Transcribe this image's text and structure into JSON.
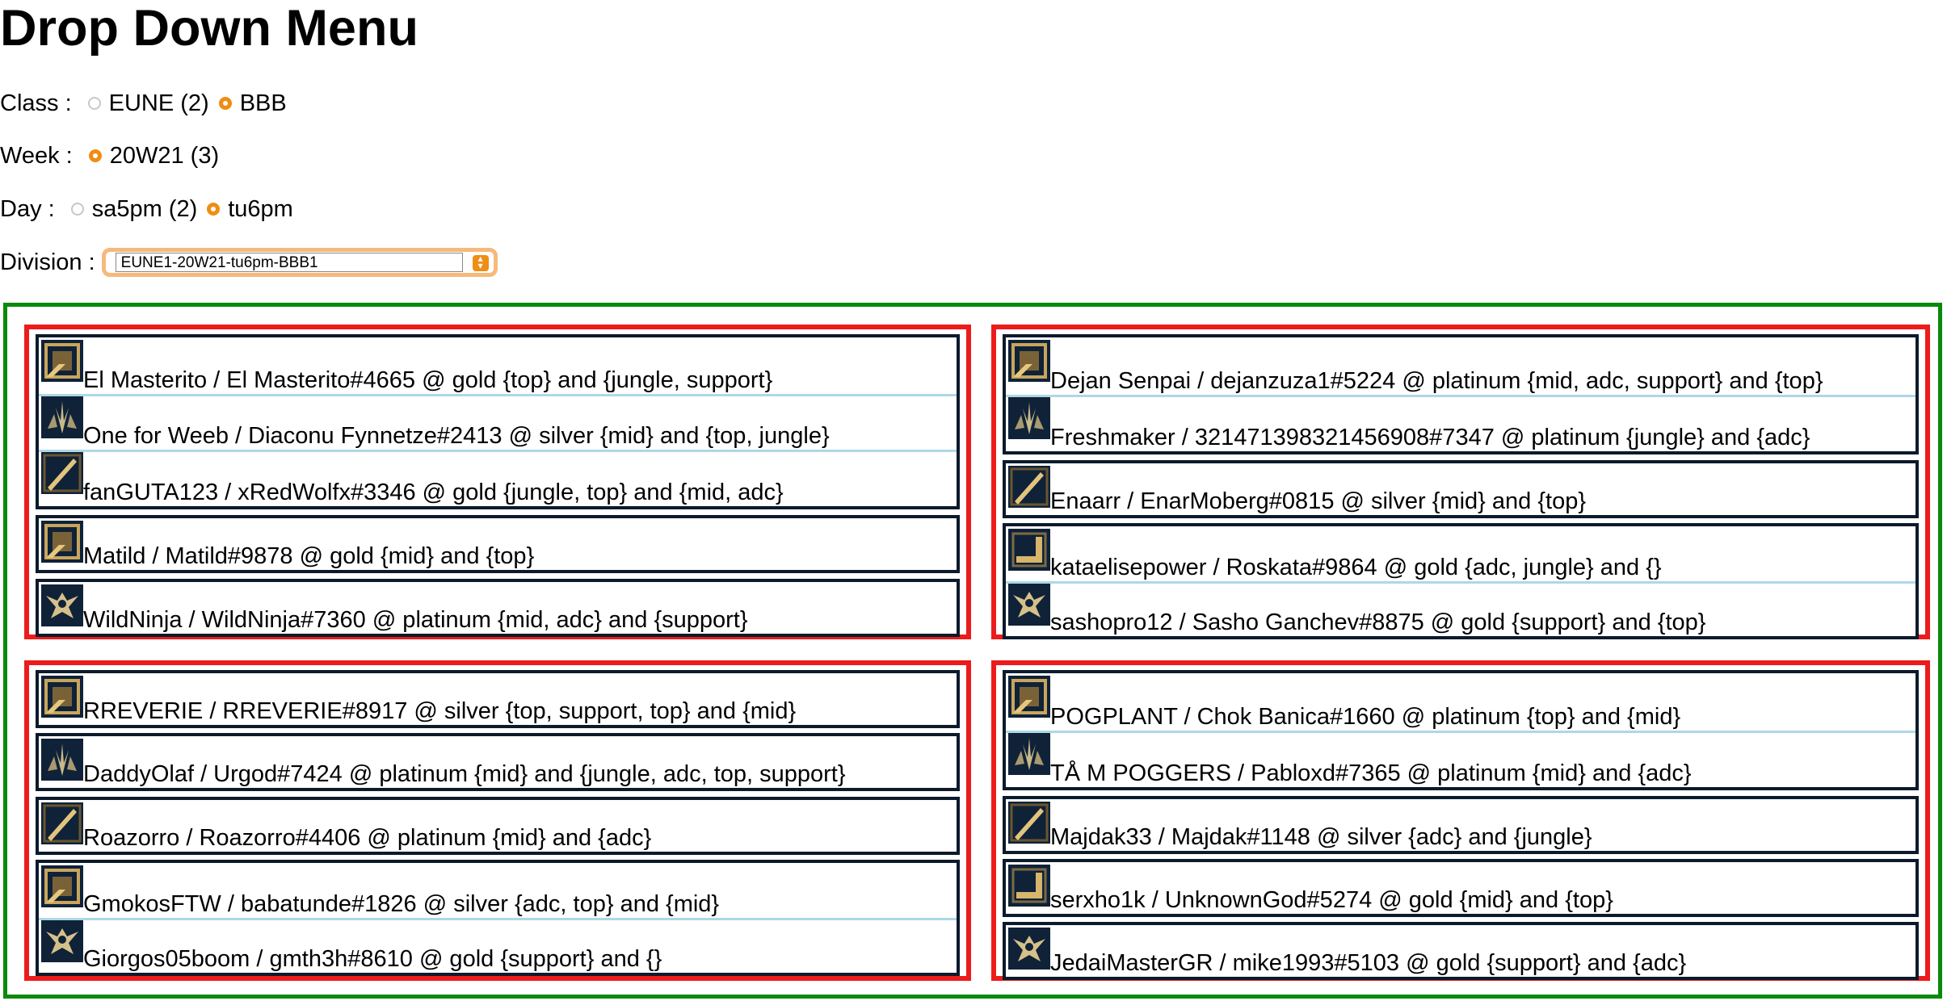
{
  "page": {
    "title": "Drop Down Menu"
  },
  "controls": {
    "class": {
      "label": "Class :",
      "options": [
        {
          "label": "EUNE (2)",
          "checked": false
        },
        {
          "label": "BBB",
          "checked": true
        }
      ]
    },
    "week": {
      "label": "Week :",
      "options": [
        {
          "label": "20W21 (3)",
          "checked": true
        }
      ]
    },
    "day": {
      "label": "Day :",
      "options": [
        {
          "label": "sa5pm (2)",
          "checked": false
        },
        {
          "label": "tu6pm",
          "checked": true
        }
      ]
    },
    "division": {
      "label": "Division :",
      "selected": "EUNE1-20W21-tu6pm-BBB1"
    }
  },
  "accent_colors": {
    "outer_border": "#0a8a0a",
    "group_border": "#ec1c1c",
    "team_border": "#0c1a2c",
    "player_separator": "#add8e6",
    "radio_checked": "#ef8d14"
  },
  "groups": [
    {
      "players": [
        {
          "text": "El Masterito / El Masterito#4665 @ gold {top} and {jungle, support}",
          "icon": "square-emblem-icon"
        },
        {
          "text": "One for Weeb / Diaconu Fynnetze#2413 @ silver {mid} and {top, jungle}",
          "icon": "jungle-claw-icon"
        },
        {
          "text": "fanGUTA123 / xRedWolfx#3346 @ gold {jungle, top} and {mid, adc}",
          "icon": "blade-emblem-icon"
        },
        {
          "text": "Matild / Matild#9878 @ gold {mid} and {top}",
          "icon": "square-emblem-icon"
        },
        {
          "text": "WildNinja / WildNinja#7360 @ platinum {mid, adc} and {support}",
          "icon": "support-emblem-icon"
        }
      ]
    },
    {
      "players": [
        {
          "text": "Dejan Senpai / dejanzuza1#5224 @ platinum {mid, adc, support} and {top}",
          "icon": "square-emblem-icon"
        },
        {
          "text": "Freshmaker / 321471398321456908#7347 @ platinum {jungle} and {adc}",
          "icon": "jungle-claw-icon"
        },
        {
          "text": "Enaarr / EnarMoberg#0815 @ silver {mid} and {top}",
          "icon": "blade-emblem-icon"
        },
        {
          "text": "kataelisepower / Roskata#9864 @ gold {adc, jungle} and {}",
          "icon": "corner-emblem-icon"
        },
        {
          "text": "sashopro12 / Sasho Ganchev#8875 @ gold {support} and {top}",
          "icon": "support-emblem-icon"
        }
      ]
    },
    {
      "players": [
        {
          "text": "RREVERIE / RREVERIE#8917 @ silver {top, support, top} and {mid}",
          "icon": "square-emblem-icon"
        },
        {
          "text": "DaddyOlaf / Urgod#7424 @ platinum {mid} and {jungle, adc, top, support}",
          "icon": "jungle-claw-icon"
        },
        {
          "text": "Roazorro / Roazorro#4406 @ platinum {mid} and {adc}",
          "icon": "blade-emblem-icon"
        },
        {
          "text": "GmokosFTW / babatunde#1826 @ silver {adc, top} and {mid}",
          "icon": "square-emblem-icon"
        },
        {
          "text": "Giorgos05boom / gmth3h#8610 @ gold {support} and {}",
          "icon": "support-emblem-icon"
        }
      ]
    },
    {
      "players": [
        {
          "text": "POGPLANT / Chok Banica#1660 @ platinum {top} and {mid}",
          "icon": "square-emblem-icon"
        },
        {
          "text": "TÅ M POGGERS / Pabloxd#7365 @ platinum {mid} and {adc}",
          "icon": "jungle-claw-icon"
        },
        {
          "text": "Majdak33 / Majdak#1148 @ silver {adc} and {jungle}",
          "icon": "blade-emblem-icon"
        },
        {
          "text": "serxho1k / UnknownGod#5274 @ gold {mid} and {top}",
          "icon": "corner-emblem-icon"
        },
        {
          "text": "JedaiMasterGR / mike1993#5103 @ gold {support} and {adc}",
          "icon": "support-emblem-icon"
        }
      ]
    }
  ]
}
